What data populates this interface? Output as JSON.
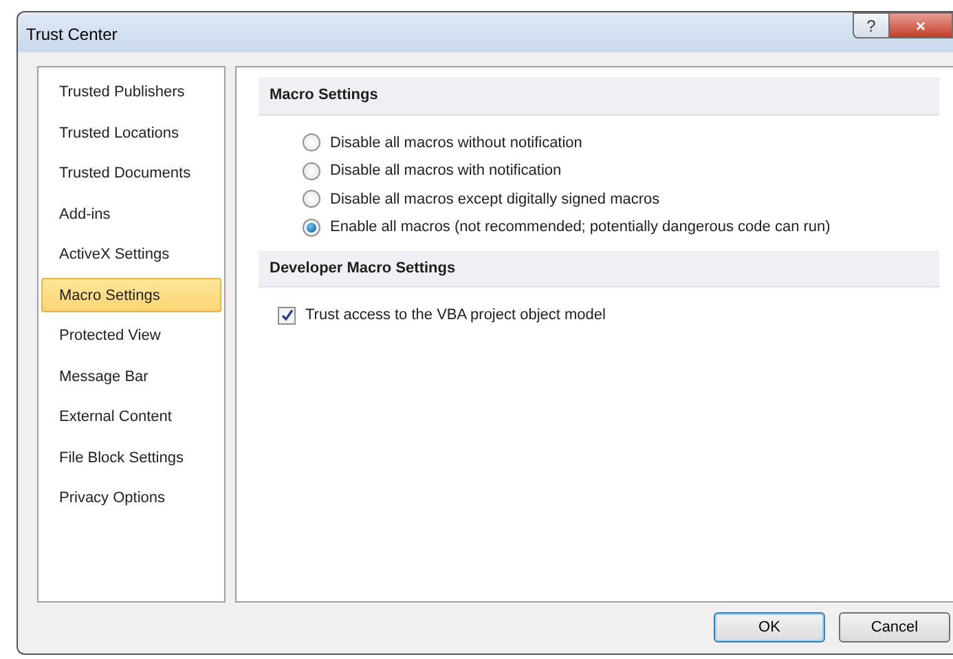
{
  "window": {
    "title": "Trust Center",
    "buttons": [
      "?",
      "×"
    ]
  },
  "sidebar": {
    "items": [
      {
        "label": "Trusted Publishers",
        "selected": false
      },
      {
        "label": "Trusted Locations",
        "selected": false
      },
      {
        "label": "Trusted Documents",
        "selected": false
      },
      {
        "label": "Add-ins",
        "selected": false
      },
      {
        "label": "ActiveX Settings",
        "selected": false
      },
      {
        "label": "Macro Settings",
        "selected": true
      },
      {
        "label": "Protected View",
        "selected": false
      },
      {
        "label": "Message Bar",
        "selected": false
      },
      {
        "label": "External Content",
        "selected": false
      },
      {
        "label": "File Block Settings",
        "selected": false
      },
      {
        "label": "Privacy Options",
        "selected": false
      }
    ]
  },
  "sections": [
    {
      "title": "Macro Settings",
      "options": [
        {
          "kind": "radio",
          "label": "Disable all macros without notification",
          "selected": false
        },
        {
          "kind": "radio",
          "label": "Disable all macros with notification",
          "selected": false
        },
        {
          "kind": "radio",
          "label": "Disable all macros except digitally signed macros",
          "selected": false
        },
        {
          "kind": "radio",
          "label": "Enable all macros (not recommended; potentially dangerous code can run)",
          "selected": true
        }
      ]
    },
    {
      "title": "Developer Macro Settings",
      "options": [
        {
          "kind": "checkbox",
          "label": "Trust access to the VBA project object model",
          "checked": true
        }
      ]
    }
  ],
  "buttons": [
    "OK",
    "Cancel"
  ]
}
